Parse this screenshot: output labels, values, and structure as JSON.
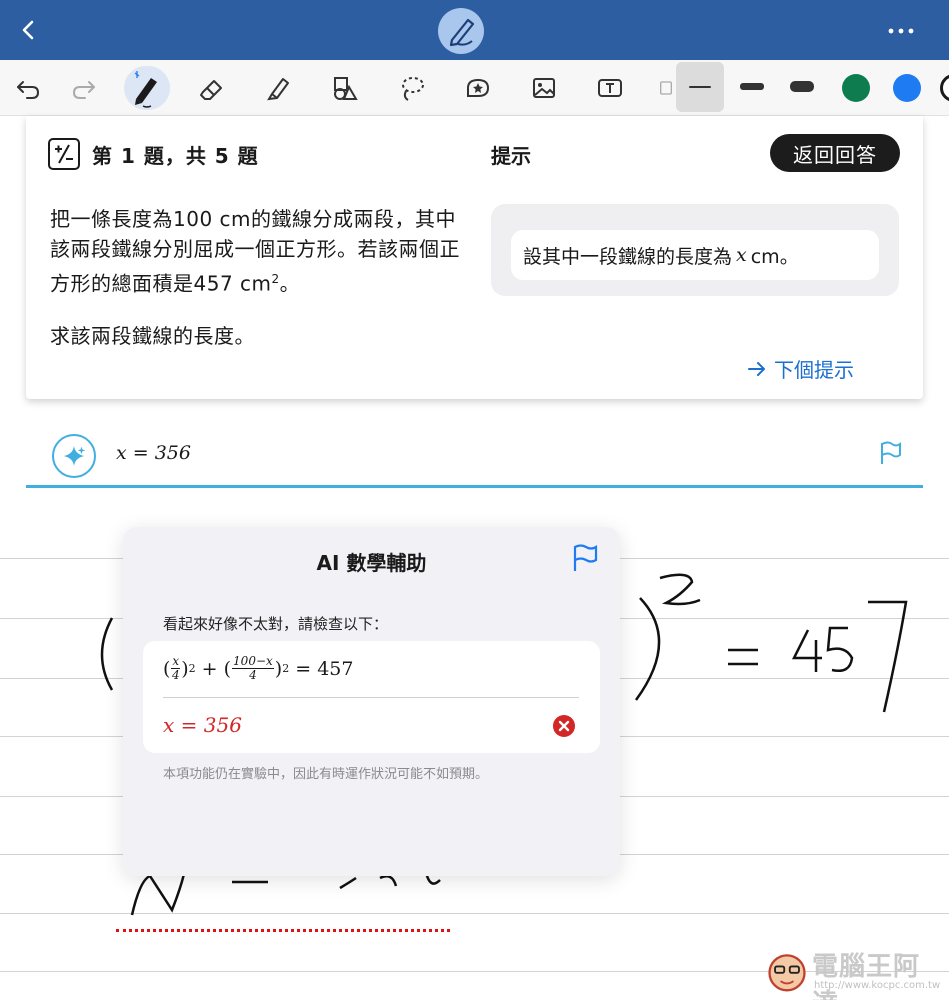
{
  "toolbar": {
    "tools": [
      "undo-icon",
      "redo-icon",
      "pen-icon",
      "eraser-icon",
      "highlighter-icon",
      "shapes-icon",
      "lasso-icon",
      "sticker-icon",
      "image-icon",
      "text-box-icon"
    ],
    "colors": [
      "#0e7c4f",
      "#1f7bf2",
      "#1a1a1a"
    ]
  },
  "question": {
    "index": "第 1 題，共 5 題",
    "text_a": "把一條長度為100 cm的鐵線分成兩段，其中該兩段鐵線分別屈成一個正方形。若該兩個正方形的總面積是457 cm",
    "text_sup": "2",
    "text_b": "。",
    "ask": "求該兩段鐵線的長度。"
  },
  "hint": {
    "title": "提示",
    "return_label": "返回回答",
    "text_a": "設其中一段鐵線的長度為",
    "var": "x",
    "text_b": "cm。",
    "next_label": "下個提示"
  },
  "answer": {
    "value": "x = 356"
  },
  "popup": {
    "title": "AI 數學輔助",
    "message": "看起來好像不太對，請檢查以下：",
    "eq": {
      "open1": "(",
      "f1_num": "x",
      "f1_den": "4",
      "close1": ")",
      "exp1": "2",
      "plus": " + (",
      "f2_num": "100−x",
      "f2_den": "4",
      "close2": ")",
      "exp2": "2",
      "rhs": " = 457"
    },
    "wrong": "x = 356",
    "note": "本項功能仍在實驗中，因此有時運作狀況可能不如預期。"
  },
  "watermark": {
    "text": "電腦王阿達",
    "url": "http://www.kocpc.com.tw"
  }
}
